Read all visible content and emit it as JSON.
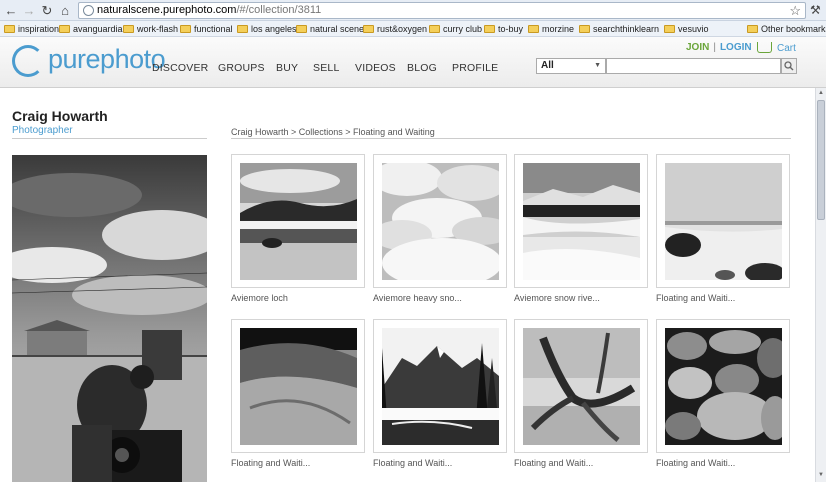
{
  "browser": {
    "url_host": "naturalscene.purephoto.com",
    "url_path": "/#/collection/3811",
    "bookmarks": [
      "inspiration",
      "avanguardia",
      "work-flash",
      "functional",
      "los angeles",
      "natural scene",
      "rust&oxygen",
      "curry club",
      "to-buy",
      "morzine",
      "searchthinklearn",
      "vesuvio"
    ],
    "other_bookmarks": "Other bookmarks"
  },
  "site": {
    "logo_a": "pure",
    "logo_b": "photo",
    "nav": [
      "DISCOVER",
      "GROUPS",
      "BUY",
      "SELL",
      "VIDEOS",
      "BLOG",
      "PROFILE"
    ],
    "join": "JOIN",
    "separator": "|",
    "login": "LOGIN",
    "cart": "Cart",
    "search_scope": "All",
    "search_placeholder": ""
  },
  "profile": {
    "name": "Craig Howarth",
    "title": "Photographer"
  },
  "breadcrumb": "Craig Howarth > Collections > Floating and Waiting",
  "photos": [
    {
      "caption": "Aviemore loch",
      "scene": "loch"
    },
    {
      "caption": "Aviemore heavy sno...",
      "scene": "snow"
    },
    {
      "caption": "Aviemore snow rive...",
      "scene": "river"
    },
    {
      "caption": "Floating and Waiti...",
      "scene": "bay"
    },
    {
      "caption": "Floating and Waiti...",
      "scene": "rock"
    },
    {
      "caption": "Floating and Waiti...",
      "scene": "valley"
    },
    {
      "caption": "Floating and Waiti...",
      "scene": "driftwood"
    },
    {
      "caption": "Floating and Waiti...",
      "scene": "pebbles"
    }
  ]
}
